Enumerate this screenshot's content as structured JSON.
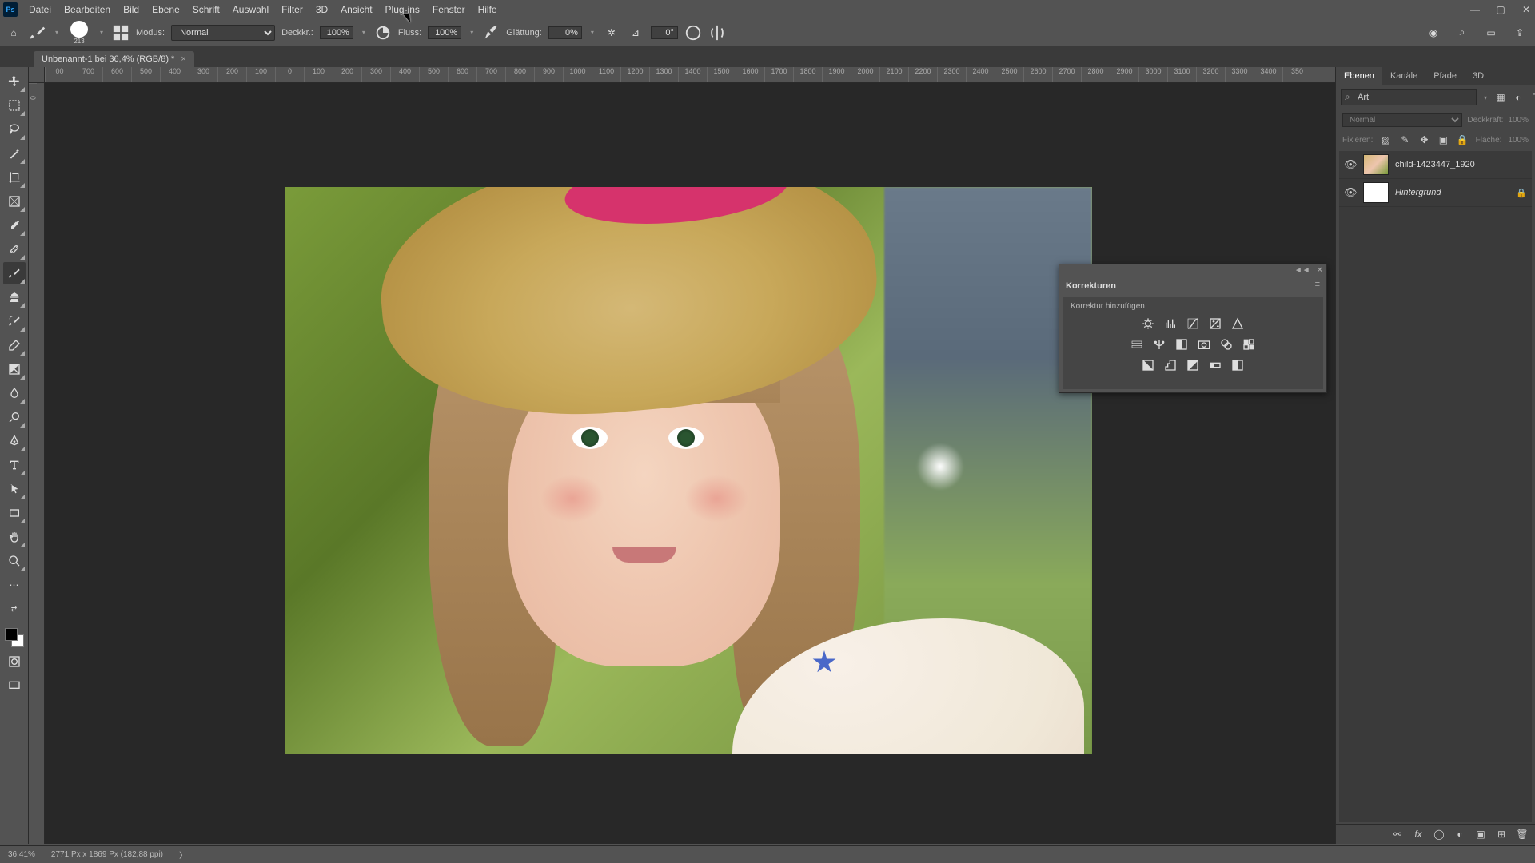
{
  "app_icon": "Ps",
  "menu": [
    "Datei",
    "Bearbeiten",
    "Bild",
    "Ebene",
    "Schrift",
    "Auswahl",
    "Filter",
    "3D",
    "Ansicht",
    "Plug-ins",
    "Fenster",
    "Hilfe"
  ],
  "options": {
    "brush_size": "213",
    "mode_label": "Modus:",
    "mode_value": "Normal",
    "opacity_label": "Deckkr.:",
    "opacity_value": "100%",
    "flow_label": "Fluss:",
    "flow_value": "100%",
    "smoothing_label": "Glättung:",
    "smoothing_value": "0%",
    "angle_value": "0°"
  },
  "document_tab": "Unbenannt-1 bei 36,4% (RGB/8) *",
  "ruler_h": [
    "00",
    "700",
    "600",
    "500",
    "400",
    "300",
    "200",
    "100",
    "0",
    "100",
    "200",
    "300",
    "400",
    "500",
    "600",
    "700",
    "800",
    "900",
    "1000",
    "1100",
    "1200",
    "1300",
    "1400",
    "1500",
    "1600",
    "1700",
    "1800",
    "1900",
    "2000",
    "2100",
    "2200",
    "2300",
    "2400",
    "2500",
    "2600",
    "2700",
    "2800",
    "2900",
    "3000",
    "3100",
    "3200",
    "3300",
    "3400",
    "350"
  ],
  "ruler_v": [
    "0",
    "",
    "",
    "",
    "",
    "",
    "",
    "",
    "",
    "",
    "",
    "",
    "",
    "",
    "",
    "",
    "",
    "",
    "",
    "",
    "",
    "",
    "",
    "",
    ""
  ],
  "adjustments": {
    "title": "Korrekturen",
    "subtitle": "Korrektur hinzufügen"
  },
  "right": {
    "tabs": [
      "Ebenen",
      "Kanäle",
      "Pfade",
      "3D"
    ],
    "search_placeholder": "Art",
    "blend_mode": "Normal",
    "opacity_label": "Deckkraft:",
    "opacity_val": "100%",
    "lock_label": "Fixieren:",
    "fill_label": "Fläche:",
    "fill_val": "100%",
    "layers": [
      {
        "name": "child-1423447_1920",
        "italic": false,
        "locked": false,
        "thumb": "img"
      },
      {
        "name": "Hintergrund",
        "italic": true,
        "locked": true,
        "thumb": "white"
      }
    ]
  },
  "status": {
    "zoom": "36,41%",
    "dims": "2771 Px x 1869 Px (182,88 ppi)"
  }
}
